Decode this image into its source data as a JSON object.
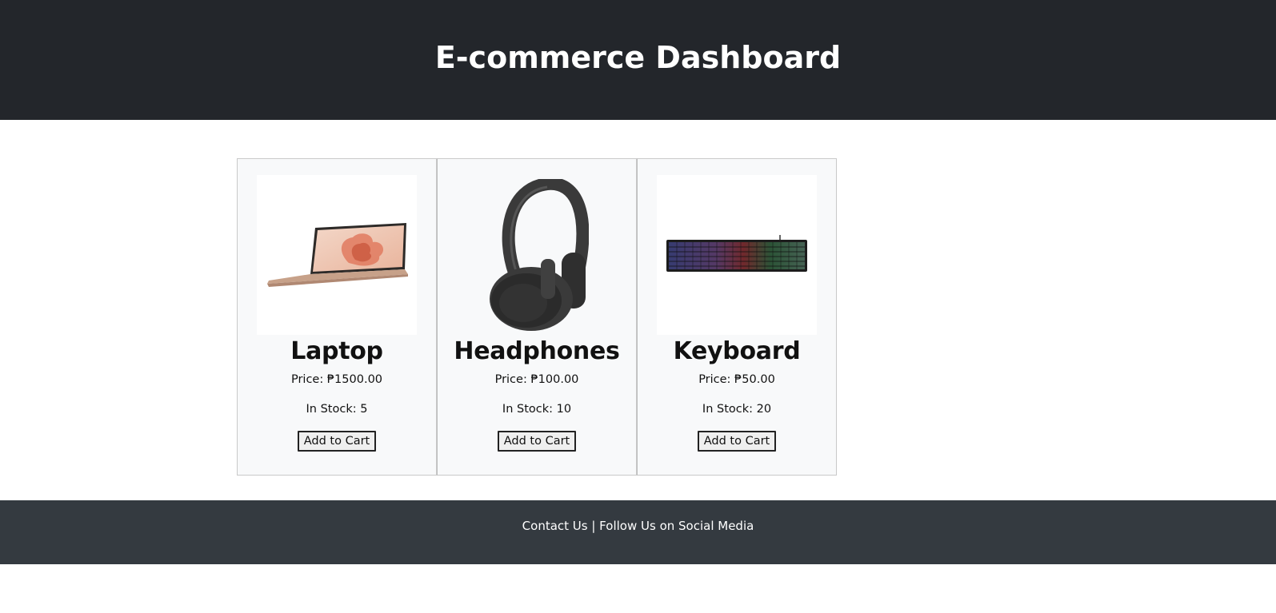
{
  "header": {
    "title": "E-commerce Dashboard"
  },
  "products": [
    {
      "name": "Laptop",
      "price": "Price: ₱1500.00",
      "stock": "In Stock: 5",
      "button": "Add to Cart",
      "image": "laptop-image"
    },
    {
      "name": "Headphones",
      "price": "Price: ₱100.00",
      "stock": "In Stock: 10",
      "button": "Add to Cart",
      "image": "headphones-image"
    },
    {
      "name": "Keyboard",
      "price": "Price: ₱50.00",
      "stock": "In Stock: 20",
      "button": "Add to Cart",
      "image": "keyboard-image"
    }
  ],
  "footer": {
    "text": "Contact Us | Follow Us on Social Media"
  },
  "colors": {
    "header_bg": "#23262b",
    "footer_bg": "#343a40",
    "card_bg": "#f8f9fa"
  }
}
